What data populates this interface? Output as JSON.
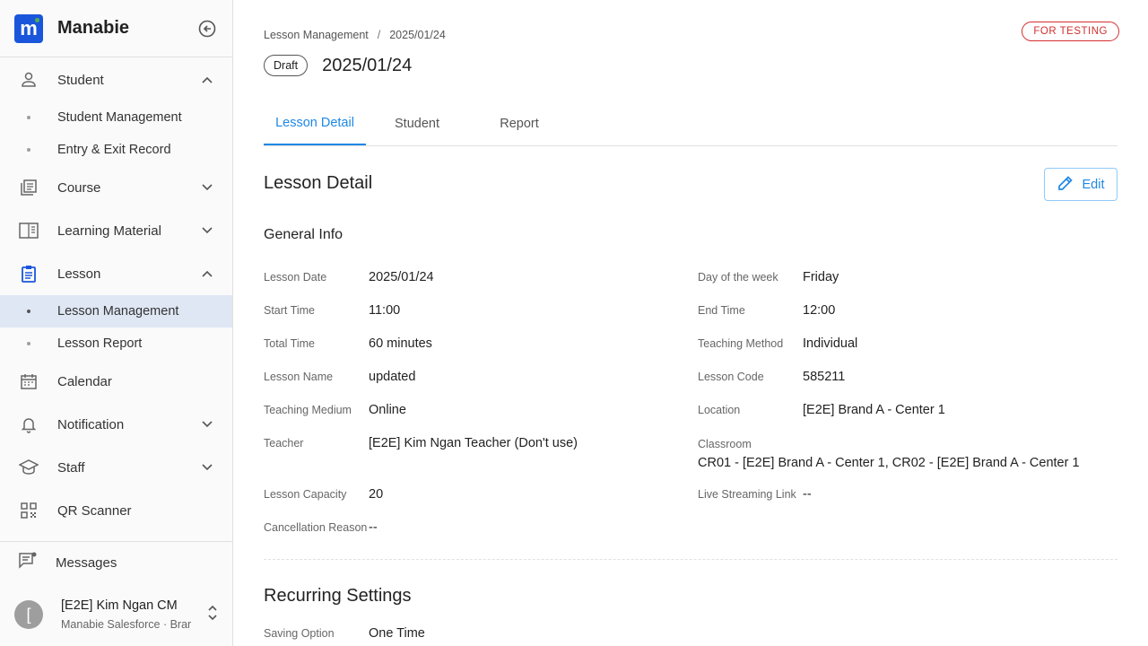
{
  "app": {
    "name": "Manabie"
  },
  "sidebar": {
    "student": {
      "label": "Student",
      "children": [
        "Student Management",
        "Entry & Exit Record"
      ]
    },
    "course": {
      "label": "Course"
    },
    "learning_material": {
      "label": "Learning Material"
    },
    "lesson": {
      "label": "Lesson",
      "children": [
        "Lesson Management",
        "Lesson Report"
      ]
    },
    "calendar": {
      "label": "Calendar"
    },
    "notification": {
      "label": "Notification"
    },
    "staff": {
      "label": "Staff"
    },
    "qr_scanner": {
      "label": "QR Scanner"
    },
    "messages": {
      "label": "Messages"
    },
    "account": {
      "avatar_letter": "[",
      "name": "[E2E] Kim Ngan CM",
      "org": "Manabie Salesforce · Brar"
    }
  },
  "breadcrumb": {
    "parent": "Lesson Management",
    "separator": "/",
    "current": "2025/01/24"
  },
  "badge": {
    "testing": "FOR TESTING"
  },
  "header": {
    "status": "Draft",
    "title": "2025/01/24"
  },
  "tabs": [
    "Lesson Detail",
    "Student",
    "Report"
  ],
  "lesson_detail": {
    "title": "Lesson Detail",
    "edit_label": "Edit",
    "general_info_title": "General Info",
    "fields": {
      "lesson_date": {
        "label": "Lesson Date",
        "value": "2025/01/24"
      },
      "day_of_week": {
        "label": "Day of the week",
        "value": "Friday"
      },
      "start_time": {
        "label": "Start Time",
        "value": "11:00"
      },
      "end_time": {
        "label": "End Time",
        "value": "12:00"
      },
      "total_time": {
        "label": "Total Time",
        "value": "60 minutes"
      },
      "teaching_method": {
        "label": "Teaching Method",
        "value": "Individual"
      },
      "lesson_name": {
        "label": "Lesson Name",
        "value": "updated"
      },
      "lesson_code": {
        "label": "Lesson Code",
        "value": "585211"
      },
      "teaching_medium": {
        "label": "Teaching Medium",
        "value": "Online"
      },
      "location": {
        "label": "Location",
        "value": "[E2E] Brand A - Center 1"
      },
      "teacher": {
        "label": "Teacher",
        "value": "[E2E] Kim Ngan Teacher (Don't use)"
      },
      "classroom": {
        "label": "Classroom",
        "value": "CR01 - [E2E] Brand A - Center 1, CR02 - [E2E] Brand A - Center 1"
      },
      "lesson_capacity": {
        "label": "Lesson Capacity",
        "value": "20"
      },
      "live_streaming": {
        "label": "Live Streaming Link",
        "value": "--"
      },
      "cancellation_reason": {
        "label": "Cancellation Reason",
        "value": "--"
      }
    }
  },
  "recurring": {
    "title": "Recurring Settings",
    "saving_option": {
      "label": "Saving Option",
      "value": "One Time"
    }
  },
  "colors": {
    "brand": "#1a56db",
    "accent": "#1e88e5",
    "testing": "#d32f2f",
    "active_nav_bg": "#dfe7f4"
  }
}
